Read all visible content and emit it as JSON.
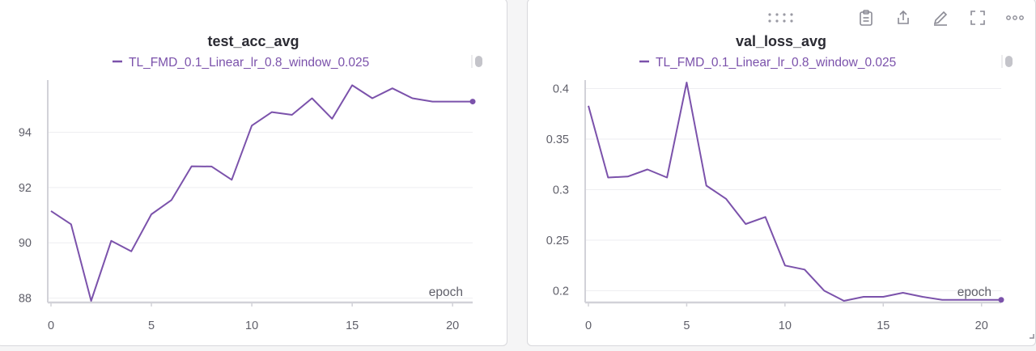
{
  "colors": {
    "series": "#7b52ab",
    "axis": "#d2d2d8",
    "grid": "#eeeef1",
    "tick": "#5f5f69",
    "title": "#2b2b33",
    "icon": "#8b8b95"
  },
  "toolbar": {
    "icons": [
      "drag-handle-icon",
      "clipboard-icon",
      "share-icon",
      "edit-icon",
      "fullscreen-icon",
      "more-icon"
    ]
  },
  "chart_data": [
    {
      "type": "line",
      "title": "test_acc_avg",
      "xlabel": "epoch",
      "ylabel": "",
      "legend_position": "top",
      "grid": true,
      "xlim": [
        0,
        21
      ],
      "ylim": [
        87.9,
        95.8
      ],
      "x_ticks": [
        0,
        5,
        10,
        15,
        20
      ],
      "y_ticks": [
        88,
        90,
        92,
        94
      ],
      "y_tick_labels": [
        "88",
        "90",
        "92",
        "94"
      ],
      "series": [
        {
          "name": "TL_FMD_0.1_Linear_lr_0.8_window_0.025",
          "x": [
            0,
            1,
            2,
            3,
            4,
            5,
            6,
            7,
            8,
            9,
            10,
            11,
            12,
            13,
            14,
            15,
            16,
            17,
            18,
            19,
            20,
            21
          ],
          "y": [
            91.15,
            90.67,
            87.9,
            90.07,
            89.69,
            91.03,
            91.55,
            92.77,
            92.76,
            92.28,
            94.24,
            94.73,
            94.63,
            95.23,
            94.49,
            95.7,
            95.23,
            95.59,
            95.23,
            95.11,
            95.11,
            95.11
          ]
        }
      ]
    },
    {
      "type": "line",
      "title": "val_loss_avg",
      "xlabel": "epoch",
      "ylabel": "",
      "legend_position": "top",
      "grid": true,
      "xlim": [
        0,
        21
      ],
      "ylim": [
        0.19,
        0.406
      ],
      "x_ticks": [
        0,
        5,
        10,
        15,
        20
      ],
      "y_ticks": [
        0.2,
        0.25,
        0.3,
        0.35,
        0.4
      ],
      "y_tick_labels": [
        "0.2",
        "0.25",
        "0.3",
        "0.35",
        "0.4"
      ],
      "series": [
        {
          "name": "TL_FMD_0.1_Linear_lr_0.8_window_0.025",
          "x": [
            0,
            1,
            2,
            3,
            4,
            5,
            6,
            7,
            8,
            9,
            10,
            11,
            12,
            13,
            14,
            15,
            16,
            17,
            18,
            19,
            20,
            21
          ],
          "y": [
            0.383,
            0.312,
            0.313,
            0.32,
            0.312,
            0.406,
            0.304,
            0.291,
            0.266,
            0.273,
            0.225,
            0.221,
            0.2,
            0.19,
            0.194,
            0.194,
            0.198,
            0.194,
            0.191,
            0.191,
            0.191,
            0.191
          ]
        }
      ]
    }
  ]
}
